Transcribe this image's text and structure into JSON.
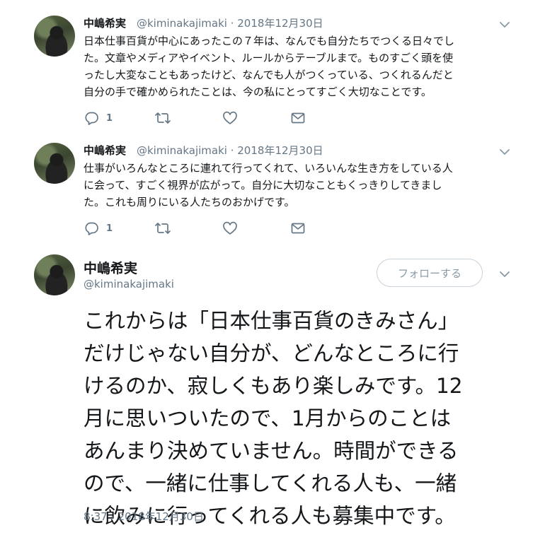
{
  "tweets": [
    {
      "name": "中嶋希実",
      "handle": "@kiminakajimaki",
      "date": "2018年12月30日",
      "lines": [
        "日本仕事百貨が中心にあったこの７年は、なんでも自分たちでつくる日々でし",
        "た。文章やメディアやイベント、ルールからテーブルまで。ものすごく頭を使",
        "ったし大変なこともあったけど、なんでも人がつくっている、つくれるんだと",
        "自分の手で確かめられたことは、今の私にとってすごく大切なことです。"
      ],
      "reply_count": "1"
    },
    {
      "name": "中嶋希実",
      "handle": "@kiminakajimaki",
      "date": "2018年12月30日",
      "lines": [
        "仕事がいろんなところに連れて行ってくれて、いろいんな生き方をしている人",
        "に会って、すごく視界が広がって。自分に大切なこともくっきりしてきまし",
        "た。これも周りにいる人たちのおかげです。"
      ],
      "reply_count": "1"
    }
  ],
  "main_tweet": {
    "name": "中嶋希実",
    "handle": "@kiminakajimaki",
    "follow_label": "フォローする",
    "lines": [
      "これからは「日本仕事百貨のきみさん」",
      "だけじゃない自分が、どんなところに行",
      "けるのか、寂しくもあり楽しみです。12",
      "月に思いついたので、1月からのことは",
      "あんまり決めていません。時間ができる",
      "ので、一緒に仕事してくれる人も、一緒",
      "に飲みに行ってくれる人も募集中です。"
    ],
    "timestamp": "8:37 - 2018年12月30日"
  },
  "icons": {
    "reply": "reply-icon",
    "retweet": "retweet-icon",
    "like": "heart-icon",
    "dm": "envelope-icon",
    "more": "chevron-down-icon"
  },
  "colors": {
    "text": "#14171a",
    "secondary": "#657786",
    "border": "#c9d1d8"
  }
}
